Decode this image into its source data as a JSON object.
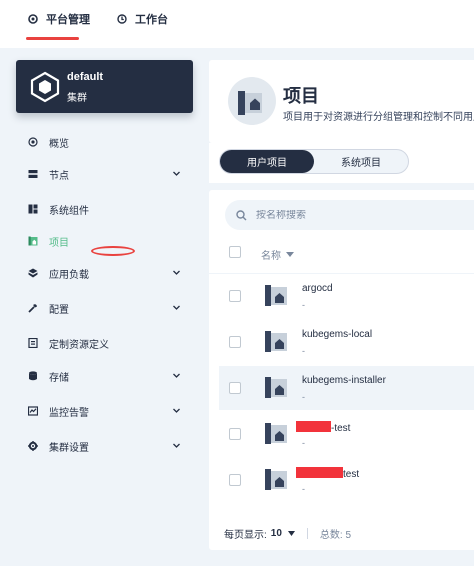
{
  "topnav": {
    "items": [
      {
        "label": "平台管理",
        "icon": "platform-icon"
      },
      {
        "label": "工作台",
        "icon": "workbench-icon"
      }
    ]
  },
  "cluster": {
    "name": "default",
    "subtitle": "集群"
  },
  "sidebar": {
    "items": [
      {
        "label": "概览",
        "icon": "overview-icon",
        "has_chevron": false
      },
      {
        "label": "节点",
        "icon": "nodes-icon",
        "has_chevron": true
      },
      {
        "label": "系统组件",
        "icon": "components-icon",
        "has_chevron": false
      },
      {
        "label": "项目",
        "icon": "project-icon",
        "has_chevron": false,
        "active": true
      },
      {
        "label": "应用负载",
        "icon": "workload-icon",
        "has_chevron": true
      },
      {
        "label": "配置",
        "icon": "config-icon",
        "has_chevron": true
      },
      {
        "label": "定制资源定义",
        "icon": "crd-icon",
        "has_chevron": false
      },
      {
        "label": "存储",
        "icon": "storage-icon",
        "has_chevron": true
      },
      {
        "label": "监控告警",
        "icon": "monitoring-icon",
        "has_chevron": true
      },
      {
        "label": "集群设置",
        "icon": "settings-icon",
        "has_chevron": true
      }
    ]
  },
  "page": {
    "title": "项目",
    "description": "项目用于对资源进行分组管理和控制不同用户"
  },
  "tabs": [
    {
      "label": "用户项目",
      "active": true
    },
    {
      "label": "系统项目",
      "active": false
    }
  ],
  "search": {
    "placeholder": "按名称搜索"
  },
  "table": {
    "column_name": "名称",
    "rows": [
      {
        "name": "argocd",
        "sub": "-",
        "redacted": false
      },
      {
        "name": "kubegems-local",
        "sub": "-",
        "redacted": false
      },
      {
        "name": "kubegems-installer",
        "sub": "-",
        "redacted": false,
        "highlight": true
      },
      {
        "name": "-test",
        "sub": "-",
        "redacted": true
      },
      {
        "name": "test",
        "sub": "-",
        "redacted": true
      }
    ]
  },
  "footer": {
    "page_size_label": "每页显示:",
    "page_size": "10",
    "total_label": "总数: 5"
  },
  "colors": {
    "dark": "#242e42",
    "accent_green": "#55bc8a",
    "annotation_red": "#e9423f",
    "background": "#eff4f9"
  }
}
